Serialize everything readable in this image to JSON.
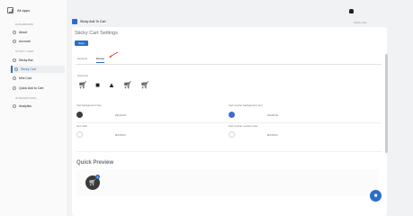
{
  "sidebar": {
    "apps_label": "All apps",
    "sections": [
      {
        "title": "DASHBOARD",
        "items": [
          {
            "label": "About"
          },
          {
            "label": "Account"
          }
        ]
      },
      {
        "title": "STICKY CART",
        "items": [
          {
            "label": "Sticky Bar"
          },
          {
            "label": "Sticky Cart"
          },
          {
            "label": "Mini Cart"
          },
          {
            "label": "Quick Add to Cart"
          }
        ]
      },
      {
        "title": "INTEGRATIONS",
        "items": [
          {
            "label": "Analytics"
          }
        ]
      }
    ],
    "active_item": "Sticky Cart"
  },
  "topbar": {
    "right_text": "Sticky Cart"
  },
  "header": {
    "app_name": "Sticky Add To Cart"
  },
  "card": {
    "title": "Sticky Cart Settings",
    "save_label": "Save",
    "tabs": [
      {
        "label": "General"
      },
      {
        "label": "Design"
      }
    ],
    "selected_tab": "Design",
    "icon_section_title": "Cart Icon",
    "icons": [
      "shopping-cart-icon",
      "shopping-bag-icon",
      "basket-icon",
      "cart-add-icon",
      "trolley-icon"
    ],
    "colors": {
      "left_1": {
        "label": "Cart background color",
        "hex": "#3C3C3C"
      },
      "right_1": {
        "label": "Cart counter background color",
        "hex": "#3A6FCE"
      },
      "left_2": {
        "label": "Icon color",
        "hex": "#FFFFFF"
      },
      "right_2": {
        "label": "Cart counter number color",
        "hex": "#FFFFFF"
      }
    }
  },
  "quick_preview": {
    "title": "Quick Preview",
    "badge_count": "0"
  },
  "accent_color": "#2c6ecb"
}
